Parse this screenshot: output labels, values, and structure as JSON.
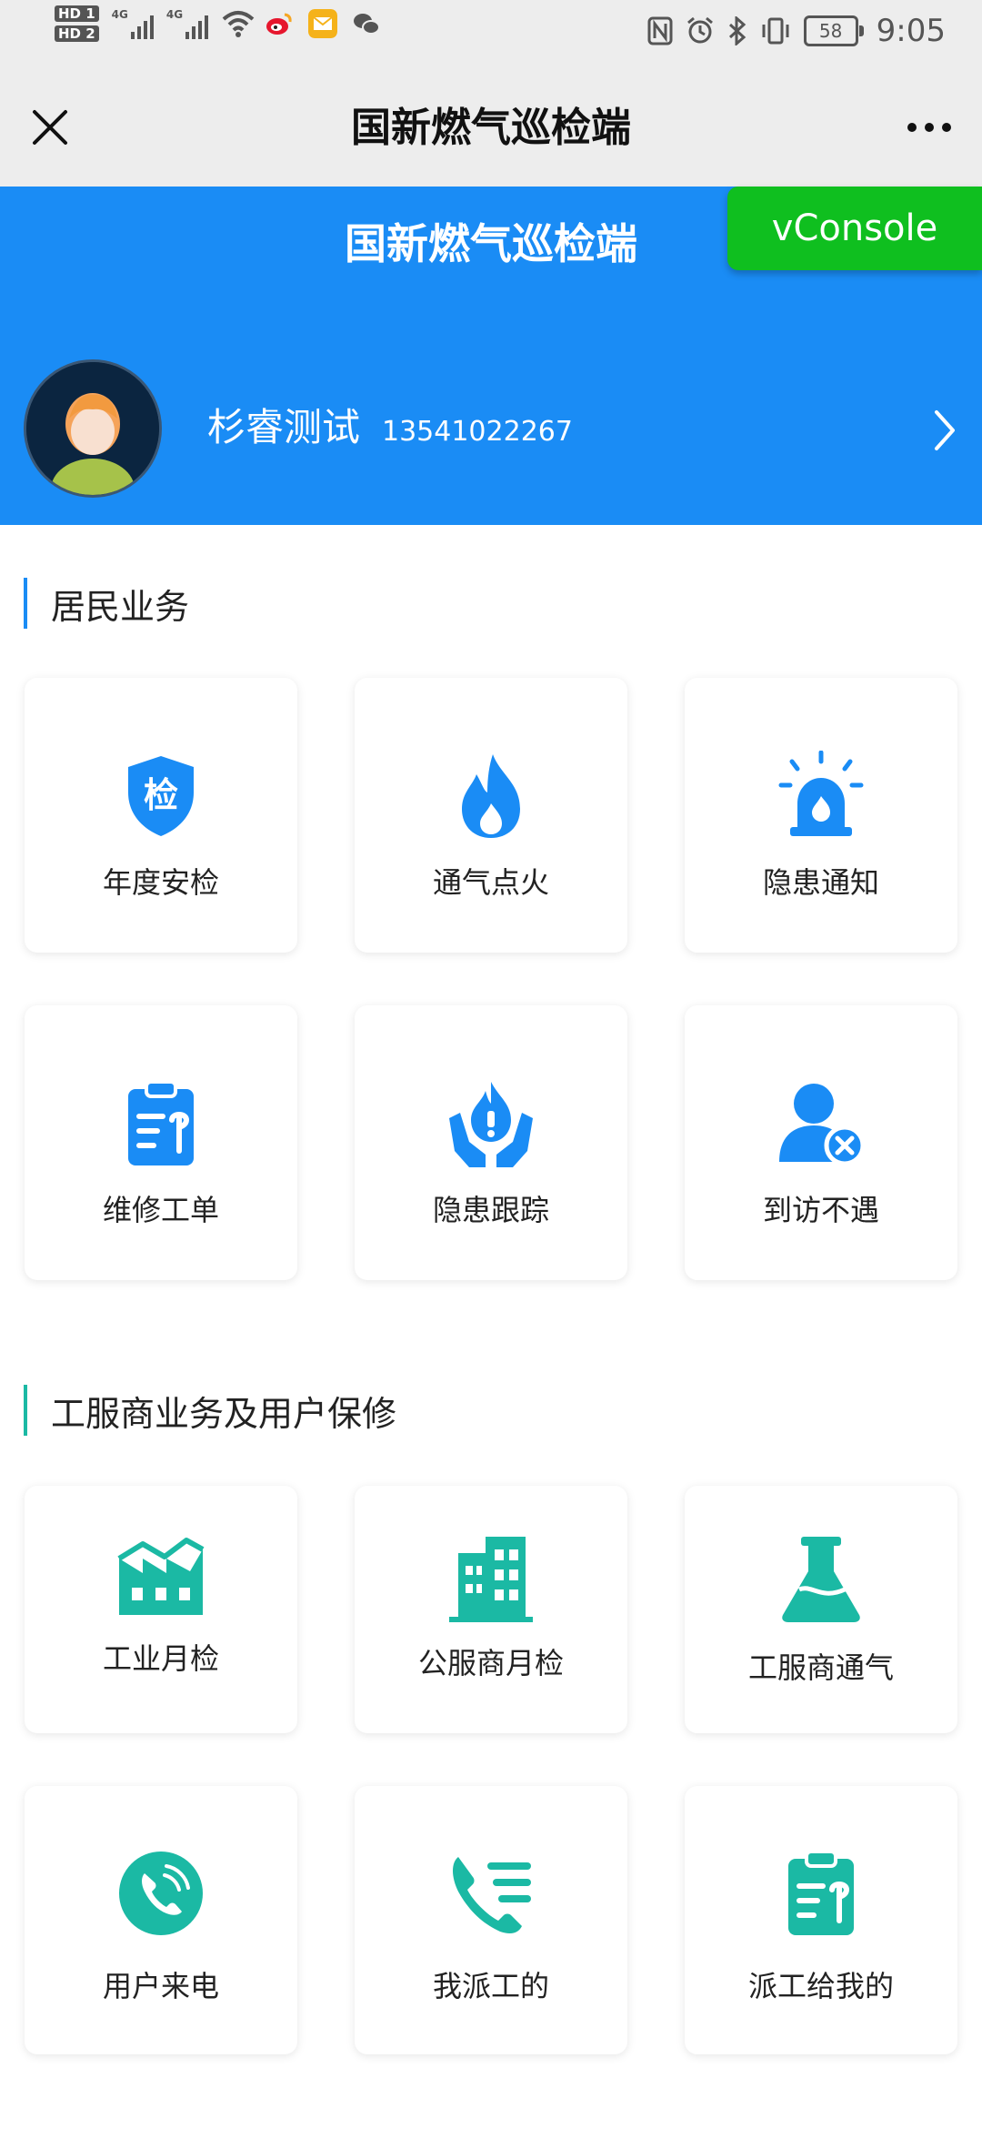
{
  "status_bar": {
    "hd1": "HD 1",
    "hd2": "HD 2",
    "net1": "4G",
    "net2": "4G",
    "battery": "58",
    "time": "9:05"
  },
  "nav": {
    "title": "国新燃气巡检端"
  },
  "header": {
    "title": "国新燃气巡检端",
    "vconsole": "vConsole",
    "user_name": "杉睿测试",
    "user_phone": "13541022267"
  },
  "colors": {
    "primary_blue": "#1a8cf5",
    "teal": "#1bb9a4",
    "vconsole_green": "#0fbf1f"
  },
  "sections": [
    {
      "title": "居民业务",
      "items": [
        {
          "label": "年度安检",
          "icon": "shield-check-icon"
        },
        {
          "label": "通气点火",
          "icon": "flame-icon"
        },
        {
          "label": "隐患通知",
          "icon": "alarm-siren-icon"
        },
        {
          "label": "维修工单",
          "icon": "clipboard-wrench-icon"
        },
        {
          "label": "隐患跟踪",
          "icon": "hands-flame-icon"
        },
        {
          "label": "到访不遇",
          "icon": "user-x-icon"
        }
      ]
    },
    {
      "title": "工服商业务及用户保修",
      "items": [
        {
          "label": "工业月检",
          "icon": "factory-chart-icon"
        },
        {
          "label": "公服商月检",
          "icon": "building-icon"
        },
        {
          "label": "工服商通气",
          "icon": "flask-icon"
        },
        {
          "label": "用户来电",
          "icon": "phone-circle-icon"
        },
        {
          "label": "我派工的",
          "icon": "phone-list-icon"
        },
        {
          "label": "派工给我的",
          "icon": "clipboard-wrench-icon"
        }
      ]
    }
  ]
}
